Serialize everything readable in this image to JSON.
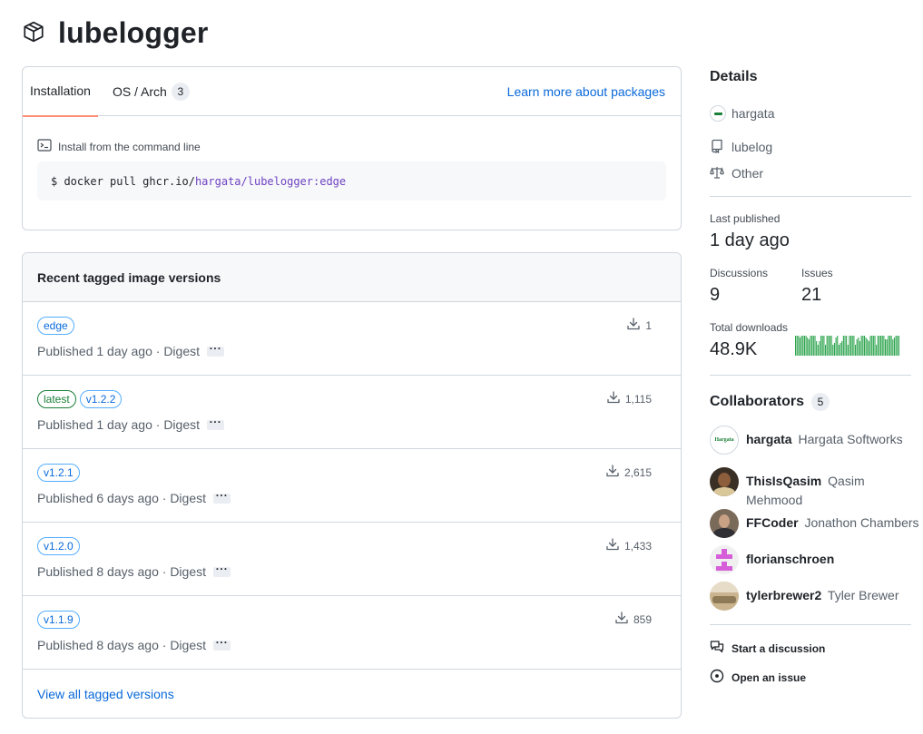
{
  "package": {
    "name": "lubelogger"
  },
  "install": {
    "tabs": [
      {
        "label": "Installation"
      },
      {
        "label": "OS / Arch",
        "count": "3"
      }
    ],
    "learn_more": "Learn more about packages",
    "cmd_label": "Install from the command line",
    "cmd_prefix": "$ docker pull ghcr.io/",
    "cmd_highlight": "hargata/lubelogger:edge"
  },
  "versions": {
    "heading": "Recent tagged image versions",
    "rows": [
      {
        "tags": [
          "edge"
        ],
        "published": "Published 1 day ago · Digest",
        "downloads": "1"
      },
      {
        "tags": [
          "latest",
          "v1.2.2"
        ],
        "published": "Published 1 day ago · Digest",
        "downloads": "1,115"
      },
      {
        "tags": [
          "v1.2.1"
        ],
        "published": "Published 6 days ago · Digest",
        "downloads": "2,615"
      },
      {
        "tags": [
          "v1.2.0"
        ],
        "published": "Published 8 days ago · Digest",
        "downloads": "1,433"
      },
      {
        "tags": [
          "v1.1.9"
        ],
        "published": "Published 8 days ago · Digest",
        "downloads": "859"
      }
    ],
    "more_label": "···",
    "view_all": "View all tagged versions"
  },
  "details": {
    "heading": "Details",
    "owner": "hargata",
    "repo": "lubelog",
    "license": "Other",
    "last_published_label": "Last published",
    "last_published": "1 day ago",
    "discussions_label": "Discussions",
    "discussions": "9",
    "issues_label": "Issues",
    "issues": "21",
    "downloads_label": "Total downloads",
    "downloads": "48.9K",
    "sparkline": [
      11,
      11,
      11,
      10,
      11,
      11,
      11,
      11,
      10,
      9,
      11,
      11,
      11,
      11,
      8,
      6,
      8,
      11,
      11,
      11,
      6,
      11,
      11,
      11,
      11,
      6,
      7,
      10,
      11,
      6,
      7,
      8,
      11,
      11,
      11,
      6,
      11,
      11,
      11,
      11,
      6,
      9,
      10,
      8,
      11,
      11,
      11,
      10,
      9,
      8,
      11,
      11,
      11,
      11,
      6,
      11,
      11,
      11,
      11,
      11,
      9,
      9,
      11,
      11,
      11,
      9,
      10,
      11,
      11,
      11
    ]
  },
  "collaborators": {
    "heading": "Collaborators",
    "count": "5",
    "people": [
      {
        "login": "hargata",
        "name": "Hargata Softworks",
        "avatar_text": "Hargata"
      },
      {
        "login": "ThisIsQasim",
        "name": "Qasim Mehmood"
      },
      {
        "login": "FFCoder",
        "name": "Jonathon Chambers"
      },
      {
        "login": "florianschroen",
        "name": ""
      },
      {
        "login": "tylerbrewer2",
        "name": "Tyler Brewer"
      }
    ]
  },
  "actions": {
    "discussion": "Start a discussion",
    "issue": "Open an issue"
  },
  "colors": {
    "accent": "#0969da",
    "tab_underline": "#fd8c73",
    "sparkline": "#2da44e",
    "latest_tag": "#1a7f37"
  }
}
